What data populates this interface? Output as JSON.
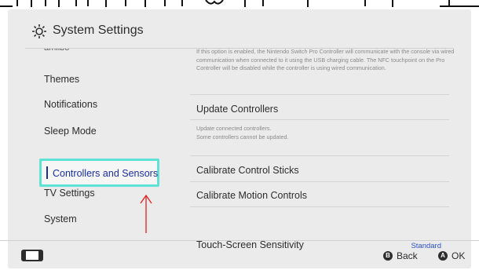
{
  "header": {
    "title": "System Settings",
    "icon": "gear-icon"
  },
  "sidebar": {
    "partial_item": "amiibo",
    "items": [
      {
        "label": "Themes"
      },
      {
        "label": "Notifications"
      },
      {
        "label": "Sleep Mode"
      },
      {
        "label": "Controllers and Sensors",
        "selected": true
      },
      {
        "label": "TV Settings"
      },
      {
        "label": "System"
      }
    ]
  },
  "content": {
    "top_description": "If this option is enabled, the Nintendo Switch Pro Controller will communicate with the console via wired communication when connected to it using the USB charging cable. The NFC touchpoint on the Pro Controller will be disabled while the controller is using wired communication.",
    "update_controllers": {
      "label": "Update Controllers",
      "description_line1": "Update connected controllers.",
      "description_line2": "Some controllers cannot be updated."
    },
    "calibrate_sticks": {
      "label": "Calibrate Control Sticks"
    },
    "calibrate_motion": {
      "label": "Calibrate Motion Controls"
    },
    "touch_screen": {
      "label": "Touch-Screen Sensitivity",
      "value": "Standard"
    }
  },
  "footer": {
    "back": {
      "button": "B",
      "label": "Back"
    },
    "ok": {
      "button": "A",
      "label": "OK"
    }
  },
  "colors": {
    "accent_selection": "#5fe2d6",
    "selected_text": "#1a2ea0",
    "value_text": "#2950c7",
    "annotation_arrow": "#e02020"
  }
}
